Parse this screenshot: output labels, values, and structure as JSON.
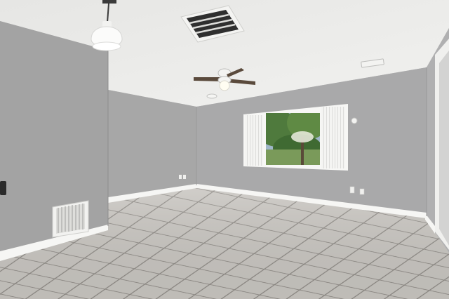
{
  "scene": {
    "description_free": true,
    "colors": {
      "ceiling": "#ececea",
      "left_wall": "#a3a3a3",
      "back_left_wall": "#a7a7a7",
      "back_wall": "#a9a9aa",
      "right_wall": "#b0b0b1",
      "baseboard": "#f6f6f4",
      "floor_tile": "#c9c6c1",
      "floor_grout": "#8f8b86",
      "trim": "#f7f7f5",
      "vent_face": "#dededb",
      "fan_blade": "#5a4a3c",
      "foliage": "#4f7a3d"
    },
    "objects": [
      "pendant-light",
      "ceiling-air-vent",
      "ceiling-fan",
      "smoke-detector",
      "window-with-vertical-blinds",
      "wall-return-vent",
      "electrical-outlets",
      "light-switch",
      "tile-floor"
    ]
  }
}
